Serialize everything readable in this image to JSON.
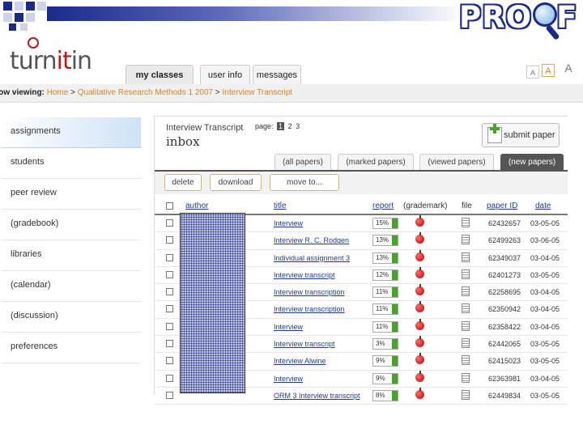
{
  "banner": {
    "proof_text": "PRO",
    "proof_tail": "F",
    "colors": {
      "navy": "#1b2a8a",
      "accent": "#b91c1c"
    }
  },
  "logo": {
    "pre": "turn",
    "it": "it",
    "post": "in"
  },
  "tabs": [
    {
      "label": "my classes",
      "active": true
    },
    {
      "label": "user info",
      "active": false
    },
    {
      "label": "messages",
      "active": false
    }
  ],
  "font_size": [
    "A",
    "A",
    "A"
  ],
  "nav": {
    "viewing_label": "Now viewing:",
    "crumbs": [
      "Home",
      "Qualitative Research Methods 1 2007",
      "Interview Transcript"
    ],
    "sep": ">"
  },
  "sidebar": [
    {
      "label": "assignments",
      "active": true
    },
    {
      "label": "students"
    },
    {
      "label": "peer review"
    },
    {
      "label": "(gradebook)"
    },
    {
      "label": "libraries"
    },
    {
      "label": "(calendar)"
    },
    {
      "label": "(discussion)"
    },
    {
      "label": "preferences"
    }
  ],
  "main": {
    "title": "Interview Transcript",
    "page_label": "page:",
    "pages": [
      "1",
      "2",
      "3"
    ],
    "current_page": "1",
    "heading": "inbox",
    "submit_label": "submit paper",
    "filter_tabs": [
      "(all papers)",
      "(marked papers)",
      "(viewed papers)",
      "(new papers)"
    ],
    "active_filter": "(new papers)",
    "actions": [
      "delete",
      "download",
      "move to..."
    ],
    "columns": {
      "author": "author",
      "title": "title",
      "report": "report",
      "grademark": "(grademark)",
      "file": "file",
      "paper_id": "paper ID",
      "date": "date"
    },
    "rows": [
      {
        "title": "Interview",
        "report": "15%",
        "paper_id": "62432657",
        "date": "03-05-05"
      },
      {
        "title": "Interview R. C. Rodgen",
        "report": "13%",
        "paper_id": "62499263",
        "date": "03-06-05"
      },
      {
        "title": "Individual assignment 3",
        "report": "13%",
        "paper_id": "62349037",
        "date": "03-04-05"
      },
      {
        "title": "Interview transcript",
        "report": "12%",
        "paper_id": "62401273",
        "date": "03-05-05"
      },
      {
        "title": "Interview transcription",
        "report": "11%",
        "paper_id": "62258695",
        "date": "03-04-05"
      },
      {
        "title": "Interview transcription",
        "report": "11%",
        "paper_id": "62350942",
        "date": "03-04-05"
      },
      {
        "title": "Interview",
        "report": "11%",
        "paper_id": "62358422",
        "date": "03-04-05"
      },
      {
        "title": "Interview transcript",
        "report": "3%",
        "paper_id": "62442065",
        "date": "03-05-05"
      },
      {
        "title": "Interview Alwine",
        "report": "9%",
        "paper_id": "62415023",
        "date": "03-05-05"
      },
      {
        "title": "Interview",
        "report": "9%",
        "paper_id": "62363981",
        "date": "03-04-05"
      },
      {
        "title": "ORM 3 Interview transcript",
        "report": "8%",
        "paper_id": "62449834",
        "date": "03-05-05"
      }
    ]
  }
}
